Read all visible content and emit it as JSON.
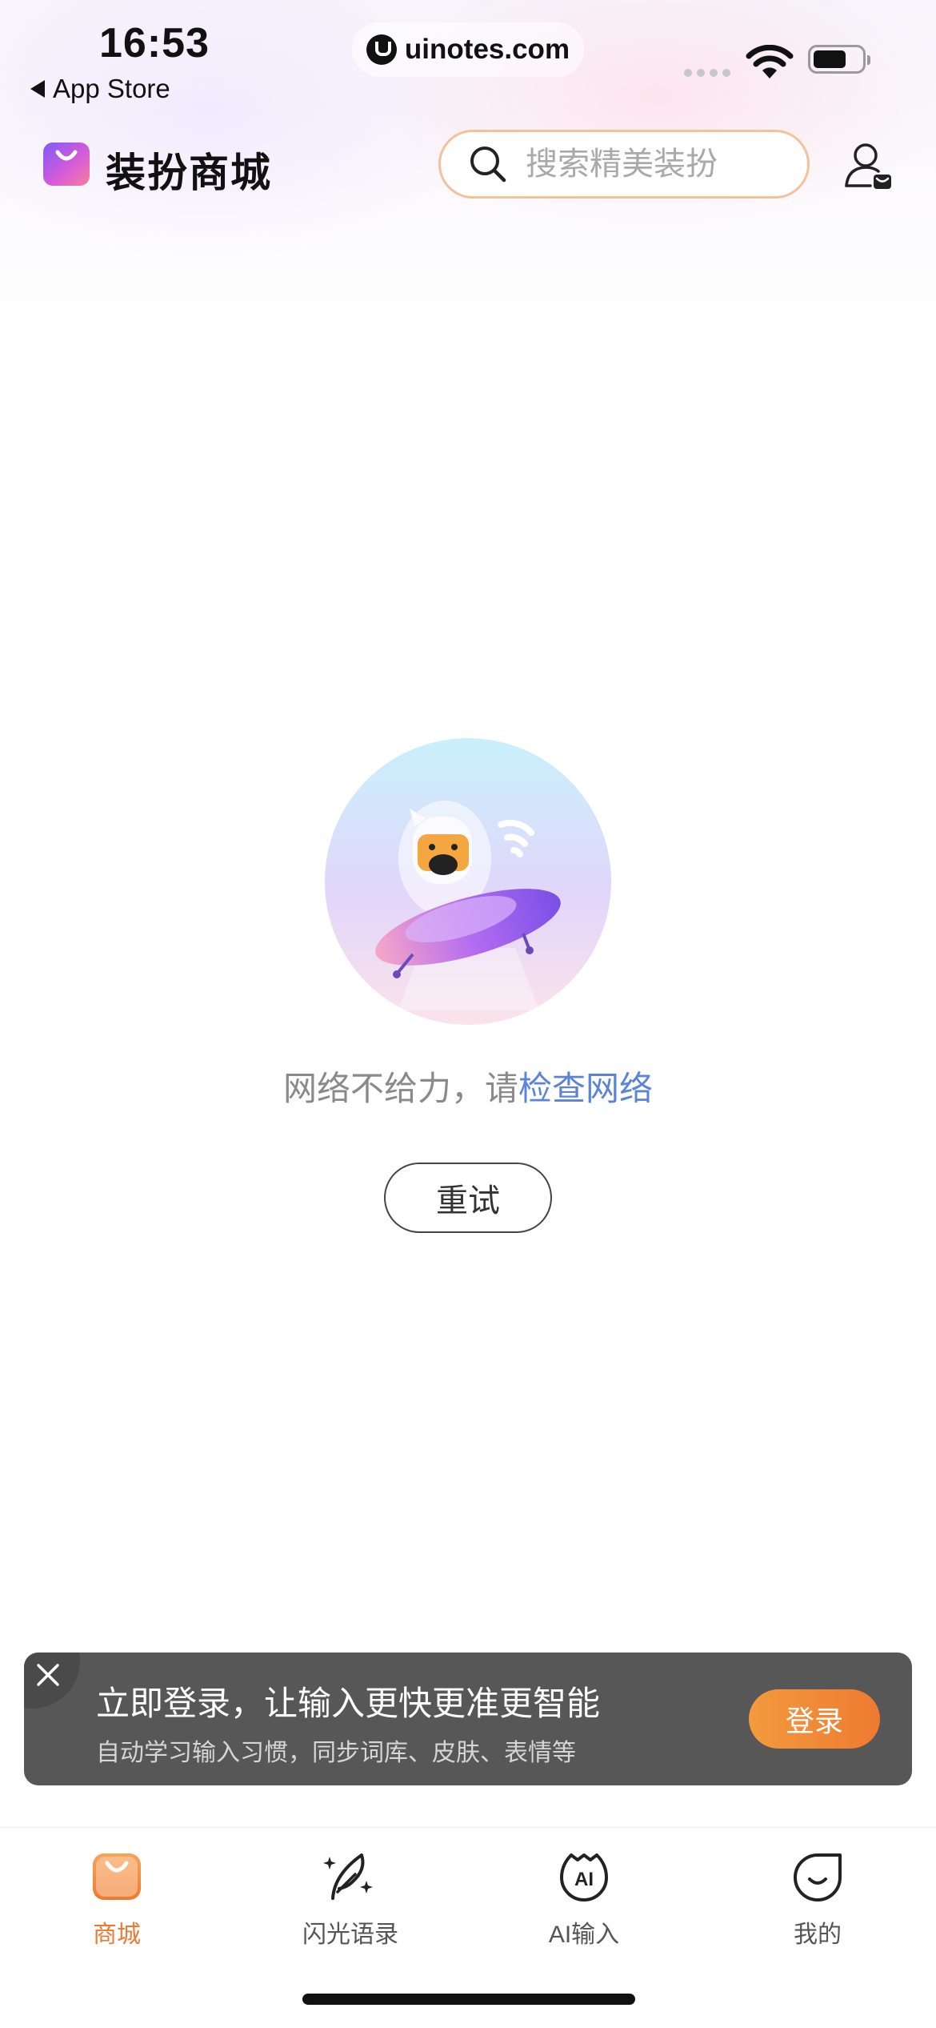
{
  "status_bar": {
    "time": "16:53",
    "back_label": "App Store",
    "url": "uinotes.com"
  },
  "header": {
    "title": "装扮商城",
    "search_placeholder": "搜索精美装扮",
    "accent_color": "#ee7a31"
  },
  "empty_state": {
    "message": "网络不给力，请",
    "link_text": "检查网络",
    "retry_label": "重试"
  },
  "login_banner": {
    "title": "立即登录，让输入更快更准更智能",
    "subtitle": "自动学习输入习惯，同步词库、皮肤、表情等",
    "button_label": "登录"
  },
  "tabbar": {
    "items": [
      {
        "label": "商城",
        "icon": "shop-bag-icon",
        "active": true
      },
      {
        "label": "闪光语录",
        "icon": "feather-sparkle-icon",
        "active": false
      },
      {
        "label": "AI输入",
        "icon": "ai-input-icon",
        "active": false
      },
      {
        "label": "我的",
        "icon": "smile-profile-icon",
        "active": false
      }
    ]
  }
}
